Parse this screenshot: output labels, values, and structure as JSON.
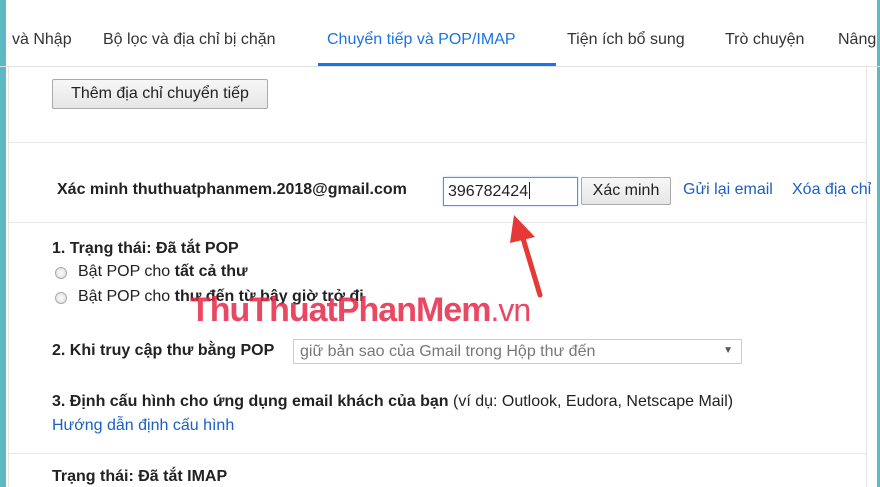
{
  "tabs": [
    {
      "label": "và Nhập"
    },
    {
      "label": "Bộ lọc và địa chỉ bị chặn"
    },
    {
      "label": "Chuyển tiếp và POP/IMAP"
    },
    {
      "label": "Tiện ích bổ sung"
    },
    {
      "label": "Trò chuyện"
    },
    {
      "label": "Nâng"
    }
  ],
  "forwarding": {
    "add_button": "Thêm địa chỉ chuyển tiếp",
    "verify_label": "Xác minh thuthuatphanmem.2018@gmail.com",
    "code_value": "396782424",
    "verify_button": "Xác minh",
    "resend_link": "Gửi lại email",
    "remove_link": "Xóa địa chỉ"
  },
  "pop": {
    "status_title": "1. Trạng thái: Đã tắt POP",
    "option_all_prefix": "Bật POP cho ",
    "option_all_bold": "tất cả thư",
    "option_now_prefix": "Bật POP cho ",
    "option_now_bold": "thư đến từ bây giờ trở đi",
    "access_label": "2. Khi truy cập thư bằng POP",
    "access_select": "giữ bản sao của Gmail trong Hộp thư đến",
    "config_title": "3. Định cấu hình cho ứng dụng email khách của bạn",
    "config_examples": "(ví dụ: Outlook, Eudora, Netscape Mail)",
    "config_link": "Hướng dẫn định cấu hình"
  },
  "imap": {
    "status_title": "Trạng thái: Đã tắt IMAP"
  },
  "watermark": {
    "brand": "ThuThuatPhanMem",
    "domain": ".vn"
  },
  "colors": {
    "accent": "#1a73e8",
    "link": "#1a5fc5",
    "arrow": "#e53935",
    "watermark": "#e62846"
  }
}
